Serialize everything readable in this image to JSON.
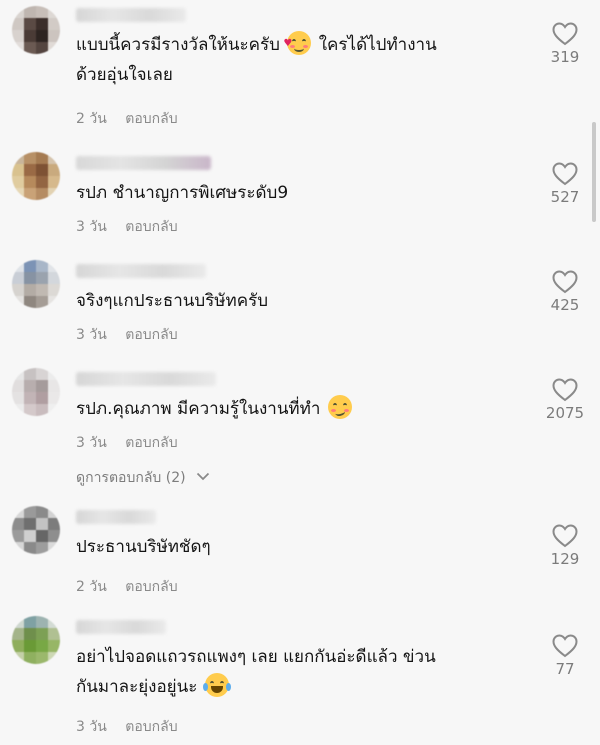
{
  "comments": [
    {
      "text": "แบบนี้ควรมีรางวัลให้นะครับ",
      "text_after_emoji": "ใครได้ไปทำงาน",
      "text_line2": "ด้วยอุ่นใจเลย",
      "emoji": "smiling-face-with-hearts",
      "time": "2 วัน",
      "reply": "ตอบกลับ",
      "likes": "319"
    },
    {
      "text": "รปภ ชำนาญการพิเศษระดับ9",
      "time": "3 วัน",
      "reply": "ตอบกลับ",
      "likes": "527"
    },
    {
      "text": "จริงๆแกประธานบริษัทครับ",
      "time": "3 วัน",
      "reply": "ตอบกลับ",
      "likes": "425"
    },
    {
      "text": "รปภ.คุณภาพ มีความรู้ในงานที่ทำ",
      "emoji": "smirking-face",
      "time": "3 วัน",
      "reply": "ตอบกลับ",
      "likes": "2075",
      "view_replies": "ดูการตอบกลับ (2)"
    },
    {
      "text": "ประธานบริษัทชัดๆ",
      "time": "2 วัน",
      "reply": "ตอบกลับ",
      "likes": "129"
    },
    {
      "text": "อย่าไปจอดแถวรถแพงๆ เลย แยกกันอ่ะดีแล้ว ข่วน",
      "text_line2": "กันมาละยุ่งอยู่นะ",
      "emoji": "face-with-tears-of-joy",
      "time": "3 วัน",
      "reply": "ตอบกลับ",
      "likes": "77"
    }
  ],
  "icons": {
    "like": "heart-outline-icon",
    "expand": "chevron-down-icon"
  },
  "colors": {
    "background": "#f7f7f7",
    "text": "#141414",
    "meta": "#8a8a8a",
    "like_count": "#7b7b7b"
  }
}
